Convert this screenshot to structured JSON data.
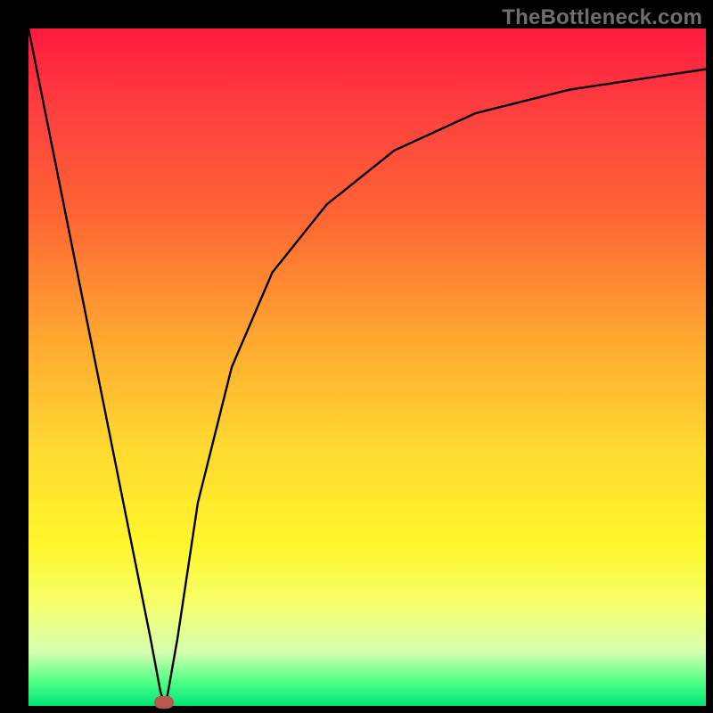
{
  "watermark": "TheBottleneck.com",
  "chart_data": {
    "type": "line",
    "title": "",
    "xlabel": "",
    "ylabel": "",
    "xlim": [
      0,
      100
    ],
    "ylim": [
      0,
      100
    ],
    "grid": false,
    "legend": false,
    "background": "red-yellow-green vertical gradient",
    "note": "Single black curve with a sharp V-shaped minimum near x≈20 then asymptotic rise; a small rounded marker sits at the minimum near the bottom.",
    "series": [
      {
        "name": "curve",
        "x": [
          0,
          4,
          8,
          12,
          16,
          18,
          19.5,
          20,
          20.5,
          22,
          25,
          30,
          36,
          44,
          54,
          66,
          80,
          100
        ],
        "y": [
          100,
          80,
          60,
          40,
          20,
          10,
          2,
          0.5,
          1.5,
          10,
          30,
          50,
          64,
          74,
          82,
          87.5,
          91,
          94
        ]
      }
    ],
    "marker": {
      "x": 20,
      "y": 0.5,
      "color": "#b9574d"
    }
  }
}
